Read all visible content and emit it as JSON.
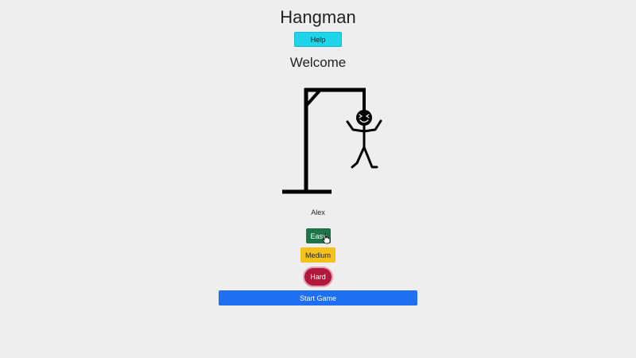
{
  "header": {
    "title": "Hangman",
    "help_label": "Help"
  },
  "status": {
    "welcome": "Welcome"
  },
  "player": {
    "name": "Alex"
  },
  "difficulty": {
    "easy_label": "Easy",
    "medium_label": "Medium",
    "hard_label": "Hard"
  },
  "actions": {
    "start_label": "Start Game"
  },
  "colors": {
    "help": "#1fd3ea",
    "easy": "#1d7447",
    "medium": "#f4c11a",
    "hard": "#b0193a",
    "start": "#1e6ff2",
    "background": "#eeedf0"
  },
  "icons": {
    "gallows": "hangman-gallows-icon",
    "cursor": "hand-pointer-icon"
  }
}
